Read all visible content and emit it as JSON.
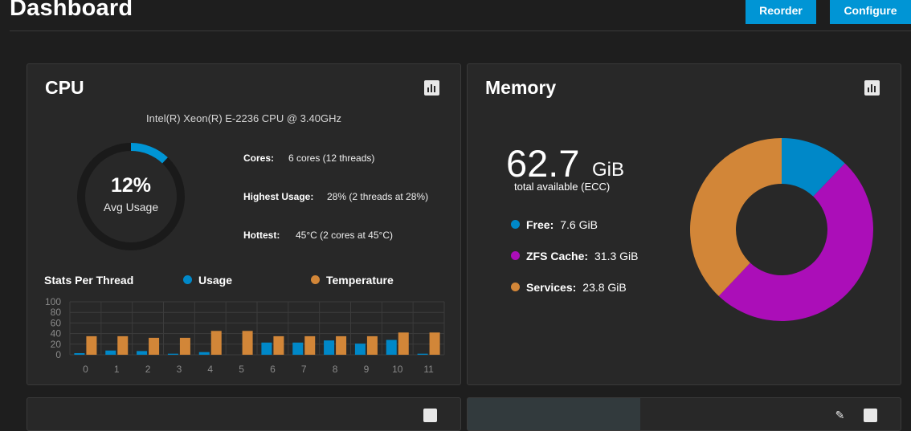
{
  "page": {
    "title": "Dashboard"
  },
  "toolbar": {
    "reorder_label": "Reorder",
    "configure_label": "Configure"
  },
  "cpu": {
    "title": "CPU",
    "model": "Intel(R) Xeon(R) E-2236 CPU @ 3.40GHz",
    "avg_usage_pct": "12%",
    "avg_usage_fraction": 0.12,
    "avg_usage_label": "Avg Usage",
    "stats": [
      {
        "label": "Cores:",
        "value": "6 cores  (12 threads)"
      },
      {
        "label": "Highest Usage:",
        "value": "28%  (2 threads at 28%)"
      },
      {
        "label": "Hottest:",
        "value": "45°C  (2 cores at 45°C)"
      }
    ],
    "legend_title": "Stats Per Thread",
    "legend": [
      {
        "name": "Usage",
        "color": "#0088c8"
      },
      {
        "name": "Temperature",
        "color": "#d28638"
      }
    ]
  },
  "memory": {
    "title": "Memory",
    "total_value": "62.7",
    "total_unit": "GiB",
    "total_sub": "total available (ECC)",
    "items": [
      {
        "label": "Free:",
        "value": "7.6 GiB",
        "color": "#0088c8"
      },
      {
        "label": "ZFS Cache:",
        "value": "31.3 GiB",
        "color": "#ab0eb8"
      },
      {
        "label": "Services:",
        "value": "23.8 GiB",
        "color": "#d28638"
      }
    ]
  },
  "chart_data": [
    {
      "type": "bar",
      "categories": [
        "0",
        "1",
        "2",
        "3",
        "4",
        "5",
        "6",
        "7",
        "8",
        "9",
        "10",
        "11"
      ],
      "series": [
        {
          "name": "Usage",
          "values": [
            3,
            8,
            7,
            2,
            5,
            0,
            23,
            23,
            27,
            21,
            28,
            2
          ],
          "color": "#0088c8"
        },
        {
          "name": "Temperature",
          "values": [
            35,
            35,
            32,
            32,
            45,
            45,
            35,
            35,
            35,
            35,
            42,
            42
          ],
          "color": "#d28638"
        }
      ],
      "ylim": [
        0,
        100
      ],
      "yticks": [
        0,
        20,
        40,
        60,
        80,
        100
      ],
      "grid": true
    },
    {
      "type": "pie",
      "donut": true,
      "categories": [
        "Free",
        "ZFS Cache",
        "Services"
      ],
      "values": [
        7.6,
        31.3,
        23.8
      ],
      "colors": [
        "#0088c8",
        "#ab0eb8",
        "#d28638"
      ]
    }
  ]
}
